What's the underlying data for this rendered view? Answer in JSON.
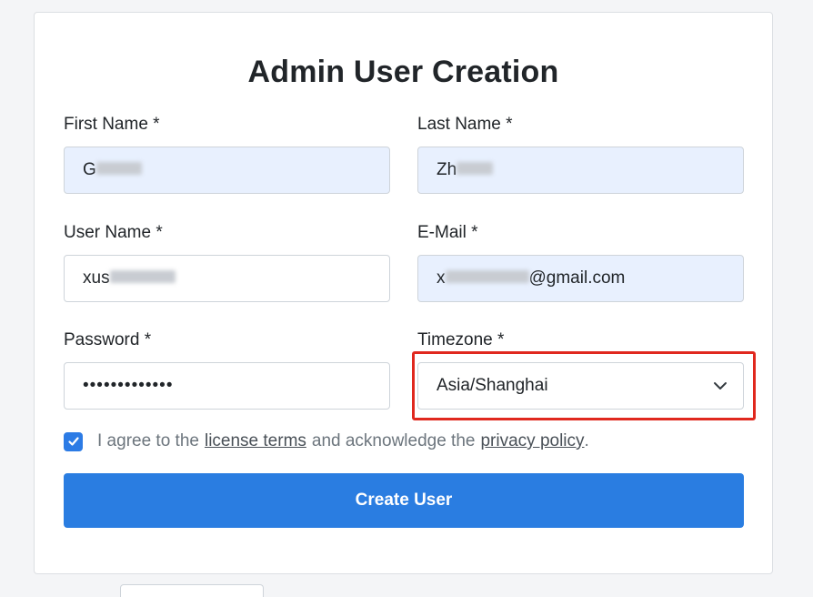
{
  "form": {
    "title": "Admin User Creation",
    "first_name": {
      "label": "First Name *",
      "value": "G"
    },
    "last_name": {
      "label": "Last Name *",
      "value": "Zh"
    },
    "user_name": {
      "label": "User Name *",
      "value": "xus"
    },
    "email": {
      "label": "E-Mail *",
      "value_prefix": "x",
      "value_suffix": "@gmail.com"
    },
    "password": {
      "label": "Password *",
      "value": "•••••••••••••"
    },
    "timezone": {
      "label": "Timezone *",
      "selected": "Asia/Shanghai"
    },
    "agree": {
      "checked": true,
      "text_before": "I agree to the",
      "license_link": "license terms",
      "text_middle": "and acknowledge the",
      "privacy_link": "privacy policy",
      "text_after": "."
    },
    "submit_label": "Create User"
  },
  "colors": {
    "primary": "#2a7de1",
    "autofill": "#e8f0fe",
    "highlight": "#e0281e"
  }
}
